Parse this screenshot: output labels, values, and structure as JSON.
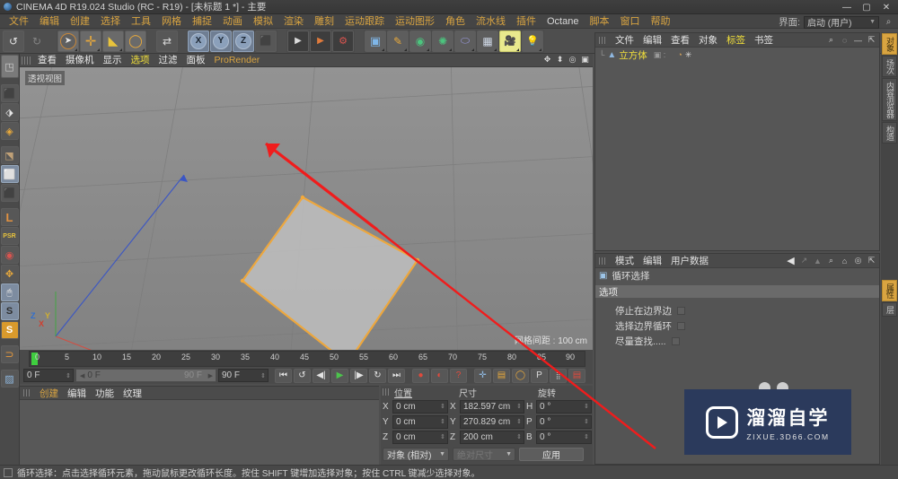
{
  "window": {
    "title": "CINEMA 4D R19.024 Studio (RC - R19) - [未标题 1 *] - 主要",
    "minimize": "—",
    "maximize": "▢",
    "close": "✕"
  },
  "menubar": {
    "items": [
      {
        "label": "文件"
      },
      {
        "label": "编辑"
      },
      {
        "label": "创建"
      },
      {
        "label": "选择"
      },
      {
        "label": "工具"
      },
      {
        "label": "网格"
      },
      {
        "label": "捕捉"
      },
      {
        "label": "动画"
      },
      {
        "label": "模拟"
      },
      {
        "label": "渲染"
      },
      {
        "label": "雕刻"
      },
      {
        "label": "运动跟踪"
      },
      {
        "label": "运动图形"
      },
      {
        "label": "角色"
      },
      {
        "label": "流水线"
      },
      {
        "label": "插件"
      },
      {
        "label": "Octane",
        "latin": true
      },
      {
        "label": "脚本"
      },
      {
        "label": "窗口"
      },
      {
        "label": "帮助"
      }
    ],
    "layout_label": "界面:",
    "layout_value": "启动 (用户)",
    "layout_arrow": "▼",
    "search_icon": "⌕"
  },
  "toolbar": {
    "undo": "↺",
    "redo": "↻",
    "tools": [
      {
        "name": "selection-tool",
        "glyph": "➤",
        "state": "sel"
      },
      {
        "name": "move-tool",
        "glyph": "✛",
        "state": "on"
      },
      {
        "name": "scale-tool",
        "glyph": "◣",
        "state": "on"
      },
      {
        "name": "rotate-tool",
        "glyph": "◯",
        "state": "on"
      }
    ],
    "axis_lock": "⇄",
    "axes": [
      {
        "label": "X"
      },
      {
        "label": "Y"
      },
      {
        "label": "Z"
      }
    ],
    "coord_system": "⬛",
    "render_view": "▶",
    "render_region": "▶",
    "render_settings": "⚙",
    "primitives": [
      {
        "name": "cube-primitive",
        "glyph": "▣"
      },
      {
        "name": "spline-pen",
        "glyph": "✎"
      },
      {
        "name": "nurbs-generator",
        "glyph": "◉"
      },
      {
        "name": "array-modeling",
        "glyph": "✺"
      },
      {
        "name": "deformer",
        "glyph": "⬭"
      },
      {
        "name": "scene-environment",
        "glyph": "▦"
      },
      {
        "name": "camera",
        "glyph": "🎥",
        "state": "hl"
      },
      {
        "name": "light",
        "glyph": "💡"
      }
    ]
  },
  "left_toolbar": {
    "items": [
      {
        "name": "make-editable",
        "glyph": "◳"
      },
      {
        "name": "model-mode",
        "glyph": "⬛"
      },
      {
        "name": "texture-mode",
        "glyph": "⬗"
      },
      {
        "name": "deformer-mode",
        "glyph": "◈"
      },
      {
        "name": "axis-mode",
        "glyph": "⬔"
      },
      {
        "name": "points-mode",
        "glyph": "⬜",
        "state": "sel"
      },
      {
        "name": "polygons-mode",
        "glyph": "⬛"
      },
      {
        "name": "object-axis",
        "glyph": "L"
      },
      {
        "name": "psr-coordinates",
        "glyph": "PSR"
      },
      {
        "name": "enable-axis",
        "glyph": "◉"
      },
      {
        "name": "viewport-solo",
        "glyph": "✥"
      },
      {
        "name": "snap-settings",
        "glyph": "🖱",
        "state": "sel"
      },
      {
        "name": "snap-toggle",
        "glyph": "S",
        "state": "sel"
      },
      {
        "name": "snap-quantize",
        "glyph": "S"
      },
      {
        "name": "magnet-tool",
        "glyph": "⊃"
      },
      {
        "name": "layout-cinema",
        "glyph": "▨"
      }
    ]
  },
  "viewport": {
    "menu": [
      {
        "label": "查看"
      },
      {
        "label": "摄像机"
      },
      {
        "label": "显示"
      },
      {
        "label": "选项",
        "highlight": true
      },
      {
        "label": "过滤"
      },
      {
        "label": "面板"
      },
      {
        "label": "ProRender",
        "latin": true
      }
    ],
    "corner_icons": [
      "✥",
      "⬍",
      "◎",
      "▣"
    ],
    "view_label": "透视视图",
    "grid_info": "网格间距 : 100 cm",
    "axis_x": "X",
    "axis_y": "Y",
    "axis_z": "Z"
  },
  "timeline": {
    "ticks": [
      "0",
      "5",
      "10",
      "15",
      "20",
      "25",
      "30",
      "35",
      "40",
      "45",
      "50",
      "55",
      "60",
      "65",
      "70",
      "75",
      "80",
      "85",
      "90"
    ],
    "current_frame": "0 F",
    "range_start": "0 F",
    "range_end": "90 F",
    "doc_end": "90 F",
    "buttons": [
      {
        "name": "goto-start",
        "glyph": "⏮"
      },
      {
        "name": "play-reverse-loop",
        "glyph": "↺"
      },
      {
        "name": "step-back",
        "glyph": "◀|"
      },
      {
        "name": "play",
        "glyph": "▶"
      },
      {
        "name": "step-forward",
        "glyph": "|▶"
      },
      {
        "name": "loop",
        "glyph": "↻"
      },
      {
        "name": "goto-end",
        "glyph": "⏭"
      }
    ],
    "record_buttons": [
      {
        "name": "record-keyframe",
        "glyph": "●"
      },
      {
        "name": "autokey",
        "glyph": "◐"
      },
      {
        "name": "keyframe-selection",
        "glyph": "?"
      }
    ],
    "key_toggles": [
      {
        "name": "key-position",
        "glyph": "✛"
      },
      {
        "name": "key-scale",
        "glyph": "▤"
      },
      {
        "name": "key-rotation",
        "glyph": "◯"
      },
      {
        "name": "key-param",
        "glyph": "P"
      },
      {
        "name": "key-pla",
        "glyph": "⣿"
      },
      {
        "name": "timeline-toggle",
        "glyph": "▤"
      }
    ]
  },
  "material_manager": {
    "menu": [
      {
        "label": "创建",
        "highlight": true
      },
      {
        "label": "编辑"
      },
      {
        "label": "功能"
      },
      {
        "label": "纹理"
      }
    ]
  },
  "coordinates": {
    "headers": {
      "position": "位置",
      "size": "尺寸",
      "rotation": "旋转"
    },
    "rows": [
      {
        "pos_label": "X",
        "pos_value": "0 cm",
        "size_label": "X",
        "size_value": "182.597 cm",
        "rot_label": "H",
        "rot_value": "0 °"
      },
      {
        "pos_label": "Y",
        "pos_value": "0 cm",
        "size_label": "Y",
        "size_value": "270.829 cm",
        "rot_label": "P",
        "rot_value": "0 °"
      },
      {
        "pos_label": "Z",
        "pos_value": "0 cm",
        "size_label": "Z",
        "size_value": "200 cm",
        "rot_label": "B",
        "rot_value": "0 °"
      }
    ],
    "mode_dropdown": "对象 (相对)",
    "size_dropdown": "绝对尺寸",
    "apply_button": "应用",
    "arrow": "▼"
  },
  "object_manager": {
    "menu": [
      {
        "label": "文件"
      },
      {
        "label": "编辑"
      },
      {
        "label": "查看"
      },
      {
        "label": "对象"
      },
      {
        "label": "标签",
        "highlight": true
      },
      {
        "label": "书签"
      }
    ],
    "icons": [
      "⌕",
      "◌",
      "—",
      "⇱"
    ],
    "object_name": "立方体",
    "object_icon": "▲",
    "tag_icons": [
      "◔",
      "✳"
    ]
  },
  "attribute_manager": {
    "menu": [
      {
        "label": "模式"
      },
      {
        "label": "编辑"
      },
      {
        "label": "用户数据"
      }
    ],
    "nav_icons": [
      "◀",
      "↗",
      "▲",
      "⌕",
      "⌂",
      "◎",
      "⇱"
    ],
    "title": "循环选择",
    "title_icon": "▣",
    "section": "选项",
    "options": [
      {
        "label": "停止在边界边"
      },
      {
        "label": "选择边界循环"
      },
      {
        "label": "尽量查找....."
      }
    ]
  },
  "right_rail": {
    "tabs": [
      {
        "label": "对象",
        "active": true
      },
      {
        "label": "场次"
      },
      {
        "label": "内容浏览器"
      },
      {
        "label": "构造"
      }
    ],
    "tabs_lower": [
      {
        "label": "属性",
        "active": true
      },
      {
        "label": "层"
      }
    ]
  },
  "status_bar": {
    "text": "循环选择：点击选择循环元素，拖动鼠标更改循环长度。按住 SHIFT 键增加选择对象；按住 CTRL 键减少选择对象。"
  },
  "watermark": {
    "brand": "溜溜自学",
    "url": "ZIXUE.3D66.COM"
  },
  "colors": {
    "accent_orange": "#d9a441",
    "selection_yellow": "#f2a93b",
    "pointer_red": "#f01c1c",
    "watermark_bg": "#2b3a5c"
  }
}
